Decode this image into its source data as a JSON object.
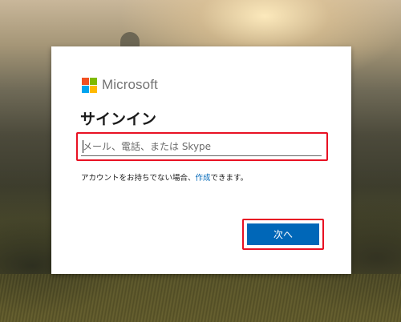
{
  "background": {
    "description_icon": "landscape-background"
  },
  "brand": {
    "name": "Microsoft",
    "logo_colors": [
      "#f25022",
      "#7fba00",
      "#00a4ef",
      "#ffb900"
    ]
  },
  "signin": {
    "title": "サインイン",
    "input_placeholder": "メール、電話、または Skype",
    "input_value": "",
    "no_account_prefix": "アカウントをお持ちでない場合、",
    "create_link": "作成",
    "no_account_suffix": "できます。",
    "next_label": "次へ"
  },
  "colors": {
    "accent": "#0067b8",
    "highlight": "#e81123"
  }
}
